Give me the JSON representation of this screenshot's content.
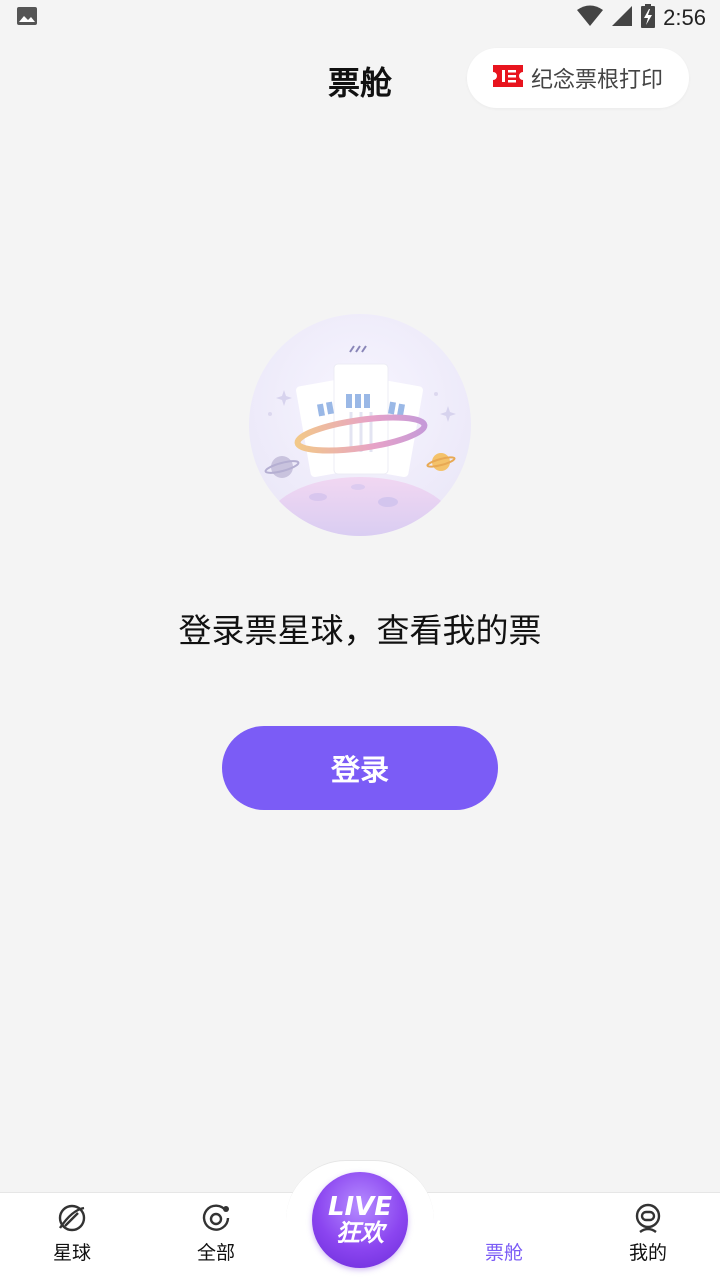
{
  "status_bar": {
    "time": "2:56",
    "icons": [
      "image-icon",
      "wifi-icon",
      "signal-icon",
      "battery-charging-icon"
    ]
  },
  "header": {
    "title": "票舱",
    "print_button_label": "纪念票根打印",
    "print_icon": "ticket-icon",
    "accent_color": "#e8141e"
  },
  "main": {
    "illustration": "ticket-planet-illustration",
    "message": "登录票星球，查看我的票",
    "login_button_label": "登录",
    "button_color": "#7b5cf6"
  },
  "bottom_nav": {
    "items": [
      {
        "label": "星球",
        "icon": "planet-icon",
        "active": false
      },
      {
        "label": "全部",
        "icon": "all-icon",
        "active": false
      },
      {
        "label": "票舱",
        "icon": "ticket-cabin-icon",
        "active": true
      },
      {
        "label": "我的",
        "icon": "profile-icon",
        "active": false
      }
    ],
    "live": {
      "line1": "LIVE",
      "line2": "狂欢"
    },
    "active_color": "#7b5cf6"
  }
}
